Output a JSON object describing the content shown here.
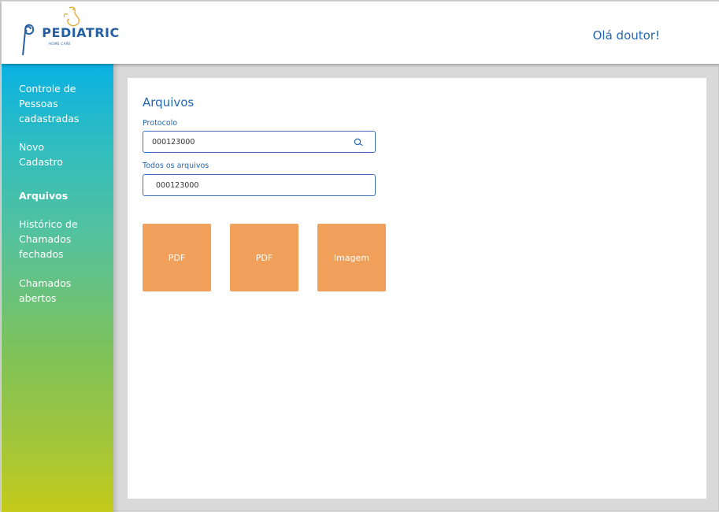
{
  "header": {
    "logo_text": "PEDIATRIC",
    "logo_subtext": "HOME CARE",
    "greeting": "Olá doutor!"
  },
  "sidebar": {
    "items": [
      {
        "label": "Controle de Pessoas cadastradas",
        "active": false
      },
      {
        "label": "Novo Cadastro",
        "active": false
      },
      {
        "label": "Arquivos",
        "active": true
      },
      {
        "label": "Histórico de Chamados fechados",
        "active": false
      },
      {
        "label": "Chamados abertos",
        "active": false
      }
    ]
  },
  "main": {
    "title": "Arquivos",
    "protocol": {
      "label": "Protocolo",
      "value": "000123000",
      "icon": "search-icon"
    },
    "all_files": {
      "label": "Todos os arquivos",
      "value": "000123000"
    },
    "files": [
      {
        "label": "PDF"
      },
      {
        "label": "PDF"
      },
      {
        "label": "Imagem"
      }
    ]
  },
  "colors": {
    "accent_blue": "#2367b1",
    "sidebar_top": "#0ab1e3",
    "sidebar_bottom": "#c4cb1a",
    "file_tile": "#f0a05a"
  }
}
